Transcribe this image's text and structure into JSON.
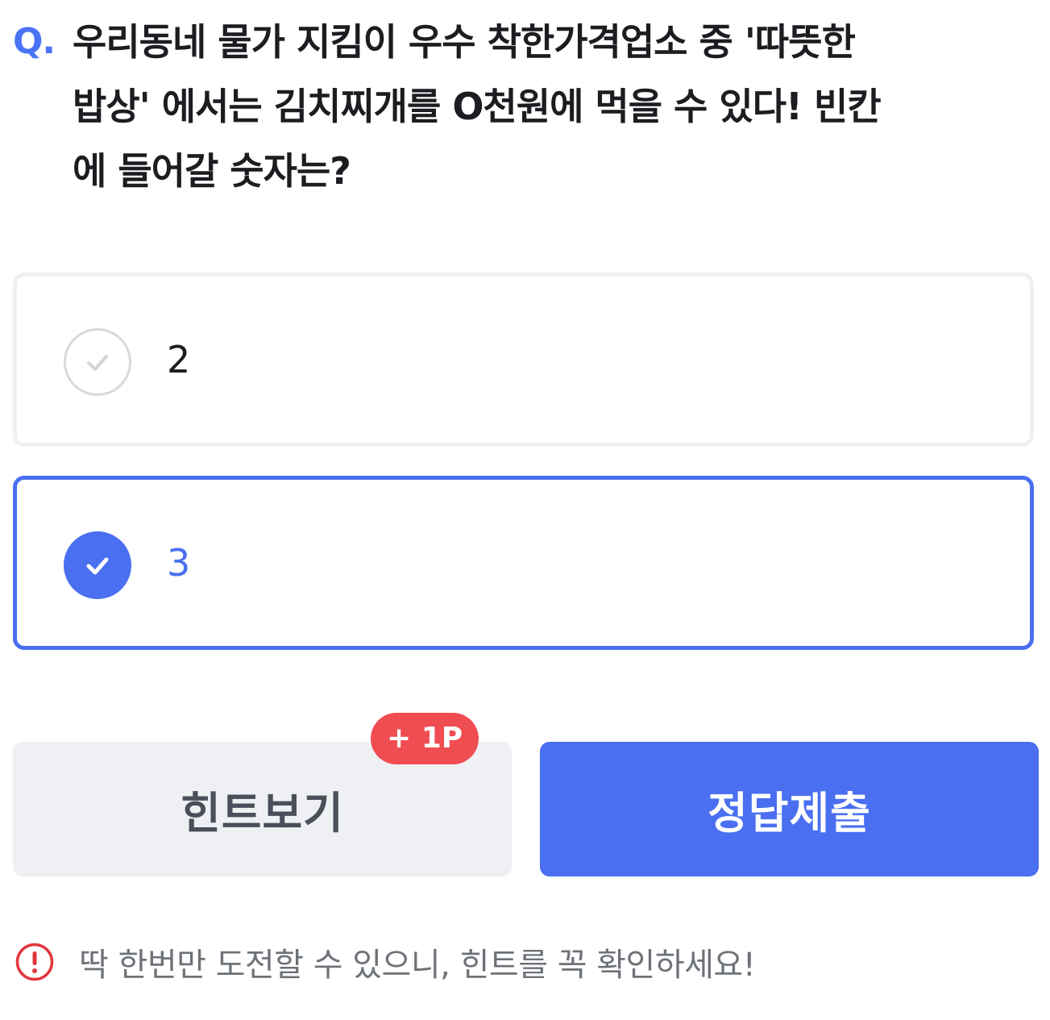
{
  "question": {
    "prefix": "Q.",
    "text": "우리동네 물가 지킴이 우수 착한가격업소 중 '따뜻한\n밥상' 에서는 김치찌개를 O천원에 먹을 수 있다! 빈칸\n에 들어갈 숫자는?"
  },
  "options": [
    {
      "label": "2",
      "selected": false
    },
    {
      "label": "3",
      "selected": true
    }
  ],
  "buttons": {
    "hint_label": "힌트보기",
    "hint_badge": "+ 1P",
    "submit_label": "정답제출"
  },
  "notice": {
    "icon": "exclamation-circle-icon",
    "text": "딱 한번만 도전할 수 있으니, 힌트를 꼭 확인하세요!"
  },
  "colors": {
    "accent": "#4a6ff0",
    "badge": "#f04d52",
    "hint_bg": "#eef0f4",
    "warning": "#e2373d"
  }
}
